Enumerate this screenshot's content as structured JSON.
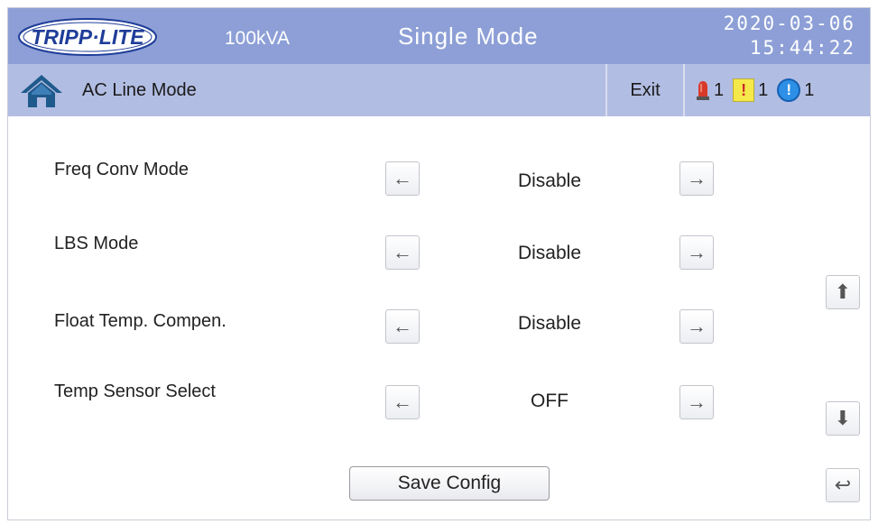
{
  "header": {
    "logo_text": "TRIPP·LITE",
    "capacity": "100kVA",
    "mode": "Single Mode",
    "date": "2020-03-06",
    "time": "15:44:22"
  },
  "status_bar": {
    "home_icon": "home-icon",
    "status": "AC Line Mode",
    "exit_label": "Exit",
    "alarms": [
      {
        "icon": "alarm-beacon-icon",
        "count": "1",
        "color": "#d83a2a"
      },
      {
        "icon": "warning-icon",
        "symbol": "!",
        "count": "1",
        "color": "#f5e84a"
      },
      {
        "icon": "info-icon",
        "symbol": "!",
        "count": "1",
        "color": "#2d8fe6"
      }
    ]
  },
  "settings": [
    {
      "label": "Freq Conv Mode",
      "value": "Disable"
    },
    {
      "label": "LBS Mode",
      "value": "Disable"
    },
    {
      "label": "Float Temp. Compen.",
      "value": "Disable"
    },
    {
      "label": "Temp Sensor Select",
      "value": "OFF"
    }
  ],
  "icons": {
    "left_arrow": "←",
    "right_arrow": "→",
    "up_arrow": "⬆",
    "down_arrow": "⬇",
    "back_arrow": "↩"
  },
  "save_label": "Save Config",
  "colors": {
    "header_bg": "#8d9fd6",
    "subbar_bg": "#b2bde3",
    "logo_blue": "#1f3d99"
  }
}
